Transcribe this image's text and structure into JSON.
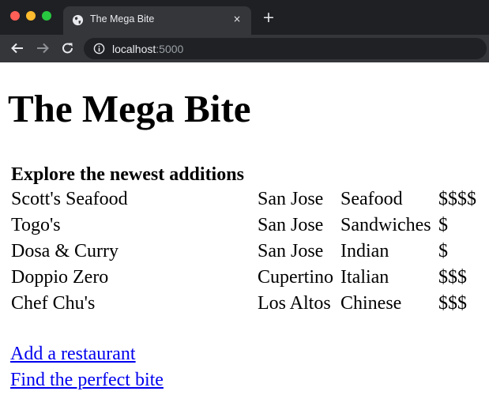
{
  "browser": {
    "tab_title": "The Mega Bite",
    "tab_close": "×",
    "new_tab": "+",
    "url_host": "localhost",
    "url_port": ":5000"
  },
  "page": {
    "heading": "The Mega Bite",
    "caption": "Explore the newest additions",
    "restaurants": [
      {
        "name": "Scott's Seafood",
        "city": "San Jose",
        "cuisine": "Seafood",
        "price": "$$$$"
      },
      {
        "name": "Togo's",
        "city": "San Jose",
        "cuisine": "Sandwiches",
        "price": "$"
      },
      {
        "name": "Dosa & Curry",
        "city": "San Jose",
        "cuisine": "Indian",
        "price": "$"
      },
      {
        "name": "Doppio Zero",
        "city": "Cupertino",
        "cuisine": "Italian",
        "price": "$$$"
      },
      {
        "name": "Chef Chu's",
        "city": "Los Altos",
        "cuisine": "Chinese",
        "price": "$$$"
      }
    ],
    "links": {
      "add": "Add a restaurant",
      "find": "Find the perfect bite"
    }
  }
}
